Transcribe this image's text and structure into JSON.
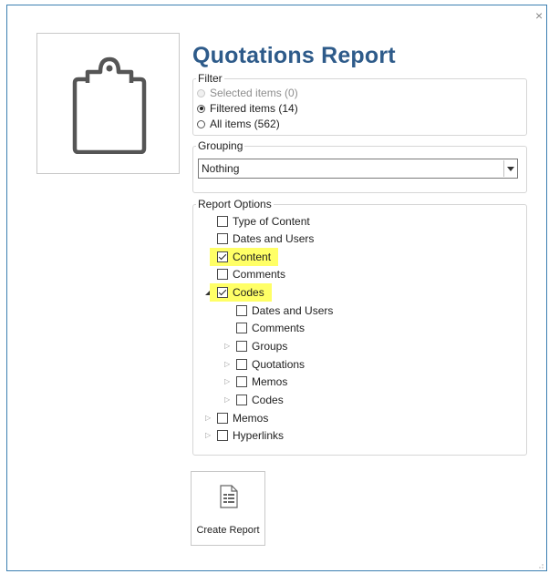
{
  "window": {
    "close_glyph": "×"
  },
  "title": "Quotations Report",
  "filter": {
    "legend": "Filter",
    "options": [
      {
        "label": "Selected items (0)",
        "state": "disabled"
      },
      {
        "label": "Filtered items (14)",
        "state": "checked"
      },
      {
        "label": "All items (562)",
        "state": "unchecked"
      }
    ]
  },
  "grouping": {
    "legend": "Grouping",
    "selected": "Nothing"
  },
  "report_options": {
    "legend": "Report Options",
    "items": [
      {
        "label": "Type of Content",
        "checked": false
      },
      {
        "label": "Dates and Users",
        "checked": false
      },
      {
        "label": "Content",
        "checked": true,
        "highlighted": true
      },
      {
        "label": "Comments",
        "checked": false
      },
      {
        "label": "Codes",
        "checked": true,
        "highlighted": true,
        "expanded": true
      },
      {
        "label": "Dates and Users",
        "checked": false
      },
      {
        "label": "Comments",
        "checked": false
      },
      {
        "label": "Groups",
        "checked": false,
        "expandable": true
      },
      {
        "label": "Quotations",
        "checked": false,
        "expandable": true
      },
      {
        "label": "Memos",
        "checked": false,
        "expandable": true
      },
      {
        "label": "Codes",
        "checked": false,
        "expandable": true
      },
      {
        "label": "Memos",
        "checked": false,
        "expandable": true
      },
      {
        "label": "Hyperlinks",
        "checked": false,
        "expandable": true
      }
    ]
  },
  "create_report": {
    "label": "Create Report"
  },
  "colors": {
    "accent": "#2e5b8a",
    "highlight": "#ffff66",
    "window_border": "#3c7fb1"
  },
  "icons": {
    "logo": "clipboard-icon",
    "report": "report-document-icon"
  }
}
